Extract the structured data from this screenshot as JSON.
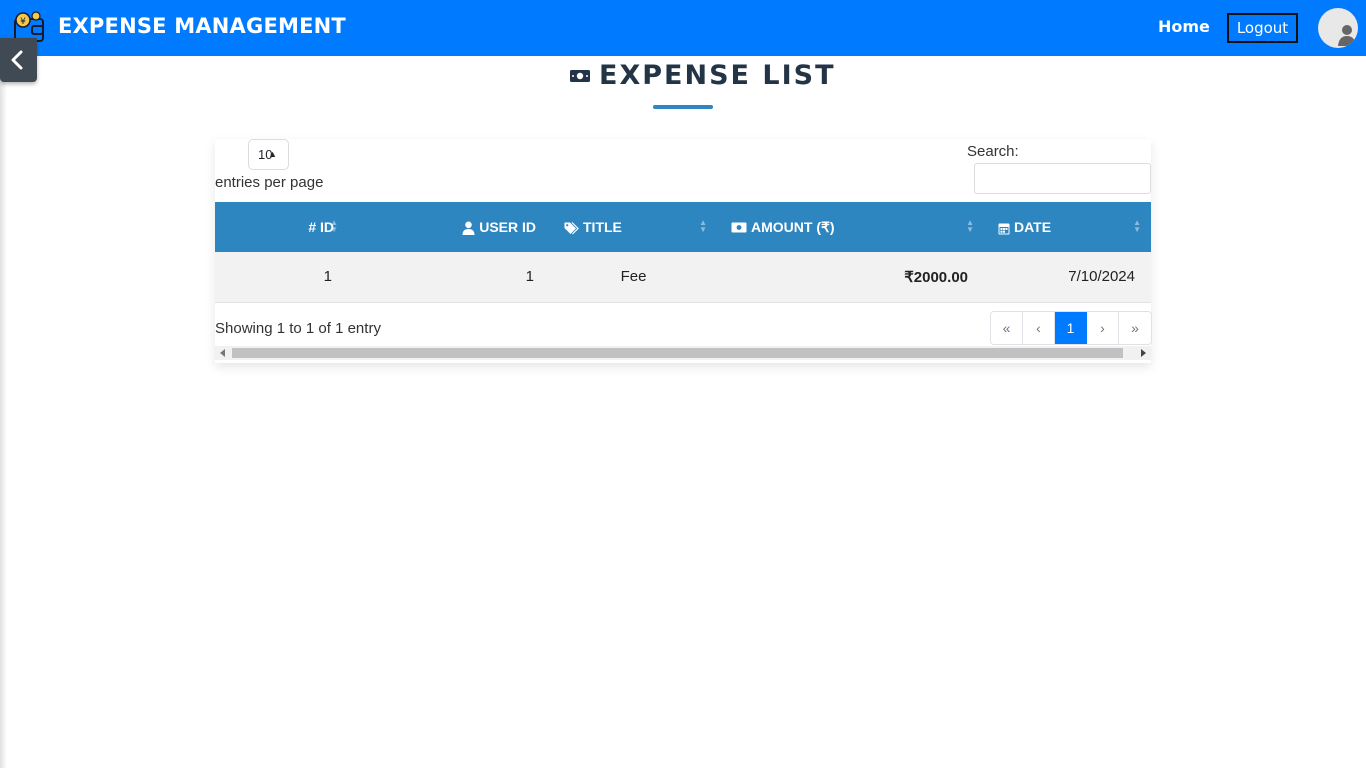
{
  "navbar": {
    "brand": "EXPENSE MANAGEMENT",
    "home": "Home",
    "logout": "Logout",
    "color": "#007bff"
  },
  "page": {
    "title": "EXPENSE LIST",
    "title_icon": "money-bill-icon"
  },
  "table_controls": {
    "page_length": "10",
    "length_label": "entries per page",
    "search_label": "Search:",
    "search_value": ""
  },
  "table": {
    "header_color": "#2e86c1",
    "columns": [
      {
        "icon": "hash-icon",
        "label": "# ID"
      },
      {
        "icon": "user-icon",
        "label": "USER ID"
      },
      {
        "icon": "tags-icon",
        "label": "TITLE"
      },
      {
        "icon": "money-bill-icon",
        "label": "AMOUNT (₹)"
      },
      {
        "icon": "calendar-icon",
        "label": "DATE"
      }
    ],
    "rows": [
      {
        "id": "1",
        "user_id": "1",
        "title": "Fee",
        "amount": "₹2000.00",
        "date": "7/10/2024"
      }
    ]
  },
  "footer": {
    "info": "Showing 1 to 1 of 1 entry",
    "pagination": [
      "«",
      "‹",
      "1",
      "›",
      "»"
    ],
    "active_page": "1"
  }
}
